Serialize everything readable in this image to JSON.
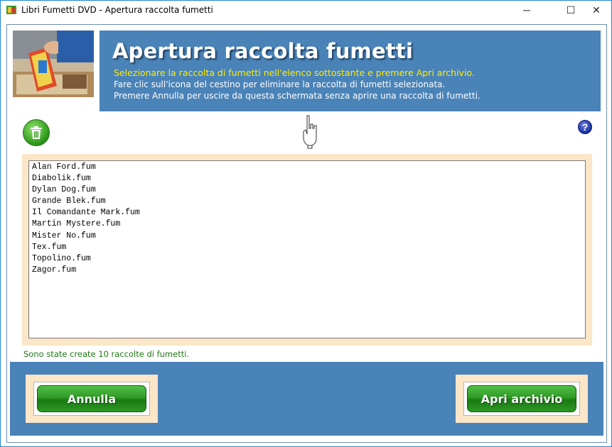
{
  "window": {
    "title": "Libri Fumetti DVD - Apertura raccolta fumetti",
    "controls": {
      "minimize": "─",
      "maximize": "☐",
      "close": "✕"
    }
  },
  "header": {
    "title": "Apertura raccolta fumetti",
    "line1": "Selezionare la raccolta di fumetti nell'elenco sottostante e premere Apri archivio.",
    "line2": "Fare clic sull'icona del cestino per eliminare la raccolta di fumetti selezionata.",
    "line3": "Premere Annulla per uscire da questa schermata senza aprire una raccolta di fumetti."
  },
  "toolbar": {
    "trash_icon": "trash-icon",
    "pointer_icon": "pointing-hand-icon",
    "help_label": "?"
  },
  "files": [
    "Alan Ford.fum",
    "Diabolik.fum",
    "Dylan Dog.fum",
    "Grande Blek.fum",
    "Il Comandante Mark.fum",
    "Martin Mystere.fum",
    "Mister No.fum",
    "Tex.fum",
    "Topolino.fum",
    "Zagor.fum"
  ],
  "status": "Sono state create 10 raccolte di fumetti.",
  "buttons": {
    "cancel": "Annulla",
    "open": "Apri archivio"
  },
  "colors": {
    "header_band": "#4a83b8",
    "highlight_text": "#ffee00",
    "status_text": "#1f7a14",
    "panel_bg": "#fbe6c8",
    "button_green": "#2f9a25"
  }
}
